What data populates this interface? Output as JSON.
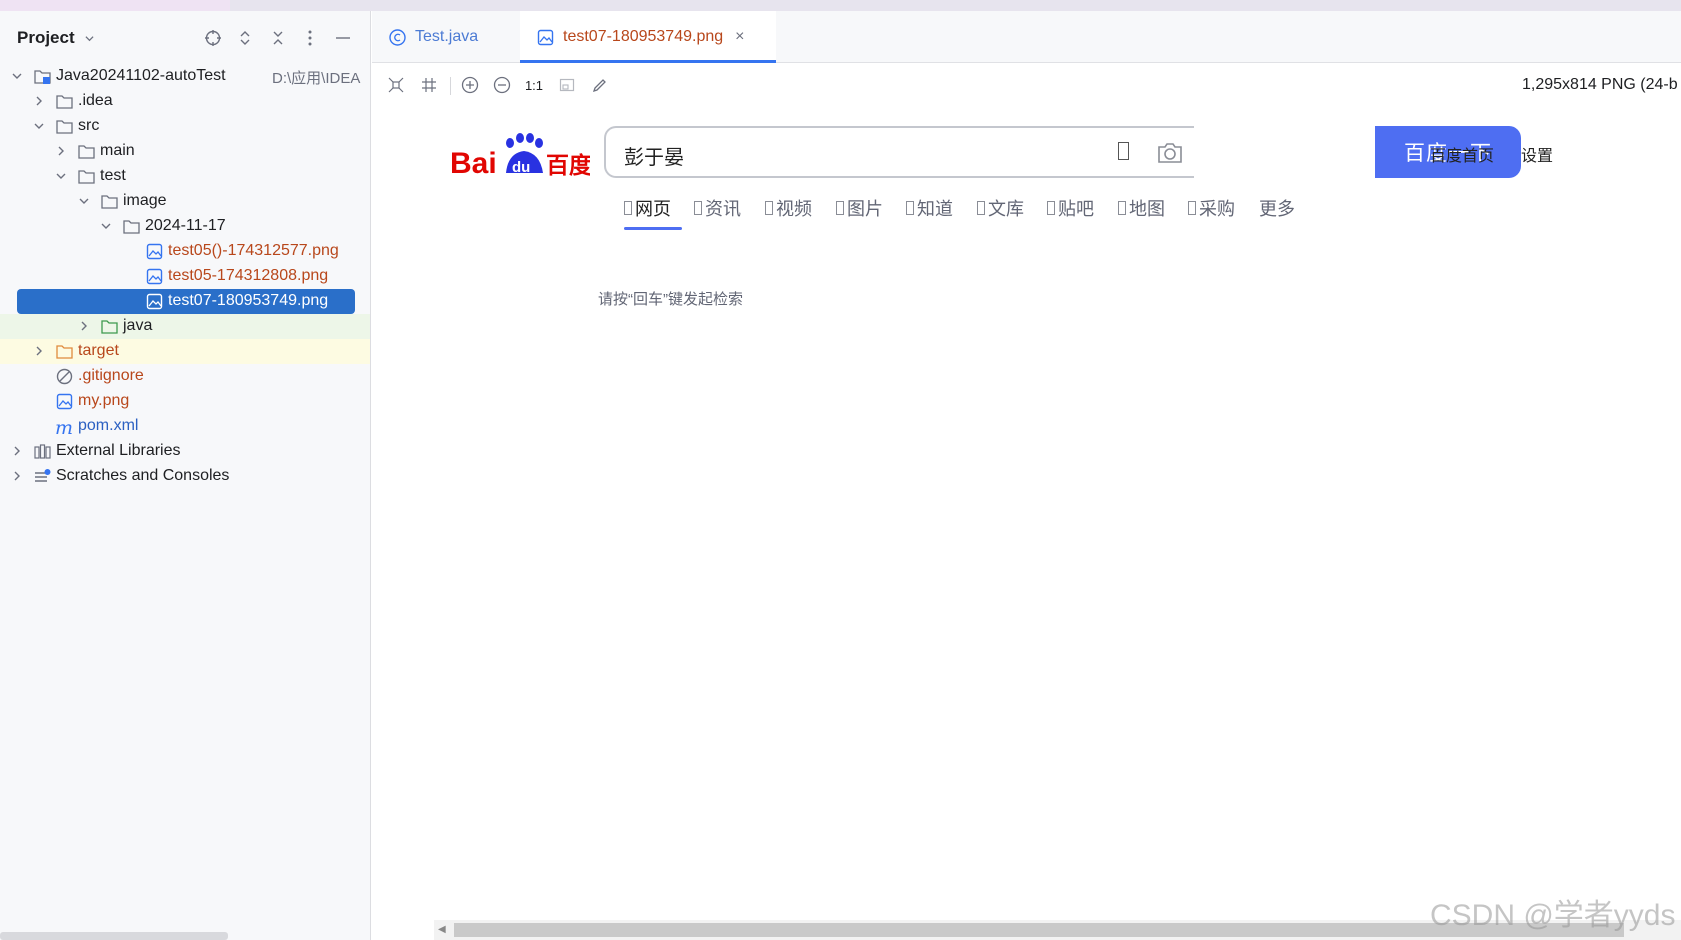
{
  "project_panel": {
    "title": "Project",
    "tree": [
      {
        "label": "Java20241102-autoTest",
        "extra": "D:\\应用\\IDEA"
      },
      {
        "label": ".idea"
      },
      {
        "label": "src"
      },
      {
        "label": "main"
      },
      {
        "label": "test"
      },
      {
        "label": "image"
      },
      {
        "label": "2024-11-17"
      },
      {
        "label": "test05()-174312577.png"
      },
      {
        "label": "test05-174312808.png"
      },
      {
        "label": "test07-180953749.png"
      },
      {
        "label": "java"
      },
      {
        "label": "target"
      },
      {
        "label": ".gitignore"
      },
      {
        "label": "my.png"
      },
      {
        "label": "pom.xml"
      },
      {
        "label": "External Libraries"
      },
      {
        "label": "Scratches and Consoles"
      }
    ]
  },
  "tabs": [
    {
      "label": "Test.java",
      "icon": "class-icon"
    },
    {
      "label": "test07-180953749.png",
      "icon": "image-file-icon",
      "close": "×"
    }
  ],
  "toolbar": {
    "actual_size": "1:1",
    "info": "1,295x814 PNG (24-b"
  },
  "baidu": {
    "logo_text": "Bai du 百度",
    "query": "彭于晏",
    "search_button": "百度一下",
    "top_links": [
      "百度首页",
      "设置"
    ],
    "nav": [
      "网页",
      "资讯",
      "视频",
      "图片",
      "知道",
      "文库",
      "贴吧",
      "地图",
      "采购",
      "更多"
    ],
    "hint": "请按“回车”键发起检索"
  },
  "watermark": "CSDN @学者yyds",
  "colors": {
    "selection": "#2a6fc9",
    "baidu_button": "#4e6ef2",
    "orange_file": "#b8471b"
  }
}
